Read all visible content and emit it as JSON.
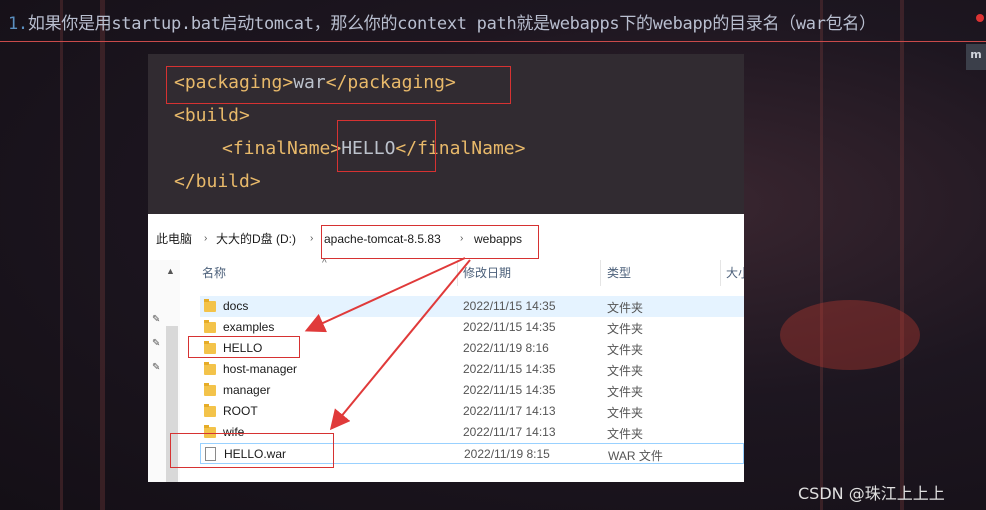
{
  "note": {
    "number": "1.",
    "text": "如果你是用startup.bat启动tomcat，那么你的context path就是webapps下的webapp的目录名（war包名）"
  },
  "side_chip": "m",
  "code": {
    "packaging_line": {
      "open": "<packaging>",
      "value": "war",
      "close": "</packaging>"
    },
    "build_open": "<build>",
    "finalname_line": {
      "open": "<finalName>",
      "value": "HELLO",
      "close": "</finalName>"
    },
    "build_close": "</build>"
  },
  "explorer": {
    "breadcrumb": [
      "此电脑",
      "大大的D盘 (D:)",
      "apache-tomcat-8.5.83",
      "webapps"
    ],
    "columns": {
      "name": "名称",
      "date": "修改日期",
      "type": "类型",
      "size": "大小"
    },
    "rows": [
      {
        "name": "docs",
        "date": "2022/11/15 14:35",
        "type": "文件夹",
        "kind": "folder"
      },
      {
        "name": "examples",
        "date": "2022/11/15 14:35",
        "type": "文件夹",
        "kind": "folder"
      },
      {
        "name": "HELLO",
        "date": "2022/11/19 8:16",
        "type": "文件夹",
        "kind": "folder"
      },
      {
        "name": "host-manager",
        "date": "2022/11/15 14:35",
        "type": "文件夹",
        "kind": "folder"
      },
      {
        "name": "manager",
        "date": "2022/11/15 14:35",
        "type": "文件夹",
        "kind": "folder"
      },
      {
        "name": "ROOT",
        "date": "2022/11/17 14:13",
        "type": "文件夹",
        "kind": "folder"
      },
      {
        "name": "wife",
        "date": "2022/11/17 14:13",
        "type": "文件夹",
        "kind": "folder"
      },
      {
        "name": "HELLO.war",
        "date": "2022/11/19 8:15",
        "type": "WAR 文件",
        "kind": "file"
      }
    ]
  },
  "colors": {
    "highlight_box": "#d63232",
    "arrow": "#e03a3a",
    "code_tag": "#e8b96a"
  },
  "watermark": "CSDN @珠江上上上"
}
